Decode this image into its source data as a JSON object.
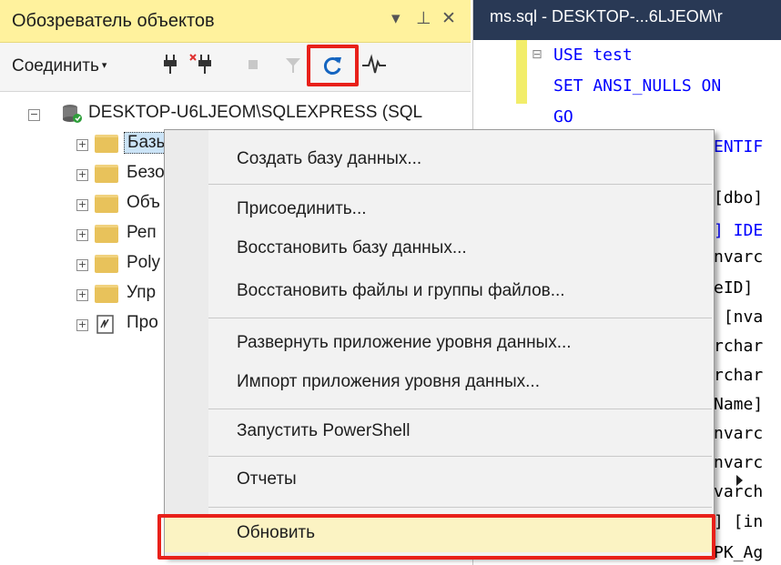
{
  "object_explorer": {
    "title": "Обозреватель объектов",
    "title_controls": {
      "dropdown": "▾",
      "pin": "⊥",
      "close": "✕"
    },
    "toolbar": {
      "connect_label": "Соединить",
      "connect_arrow": "▾"
    },
    "tree": {
      "server": "DESKTOP-U6LJEOM\\SQLEXPRESS (SQL",
      "nodes": [
        {
          "label": "Базы данных"
        },
        {
          "label": "Безо"
        },
        {
          "label": "Объ"
        },
        {
          "label": "Реп"
        },
        {
          "label": "Poly"
        },
        {
          "label": "Упр"
        },
        {
          "label": "Про"
        }
      ],
      "expand_glyph": "+",
      "collapse_glyph": "−"
    }
  },
  "editor": {
    "tab_title": "ms.sql - DESKTOP-...6LJEOM\\r",
    "collapse_glyph": "⊟",
    "lines": [
      {
        "text": "USE test"
      },
      {
        "text": "SET ANSI_NULLS ON"
      },
      {
        "text": "GO"
      },
      {
        "text": "ENTIF"
      },
      {
        "text": "[dbo]"
      },
      {
        "text": "] IDE"
      },
      {
        "text": "nvarc"
      },
      {
        "text": "eID]"
      },
      {
        "text": " [nva"
      },
      {
        "text": "rchar"
      },
      {
        "text": "rchar"
      },
      {
        "text": "Name]"
      },
      {
        "text": "nvarc"
      },
      {
        "text": "nvarc"
      },
      {
        "text": "varch"
      },
      {
        "text": "] [in"
      },
      {
        "text": "PK_Ag"
      }
    ]
  },
  "context_menu": {
    "items": [
      {
        "label": "Создать базу данных..."
      },
      {
        "label": "Присоединить..."
      },
      {
        "label": "Восстановить базу данных..."
      },
      {
        "label": "Восстановить файлы и группы файлов..."
      },
      {
        "label": "Развернуть приложение уровня данных..."
      },
      {
        "label": "Импорт приложения уровня данных..."
      },
      {
        "label": "Запустить PowerShell"
      },
      {
        "label": "Отчеты"
      },
      {
        "label": "Обновить"
      }
    ]
  },
  "colors": {
    "highlight_red": "#e8201a",
    "oe_title_bg": "#fff29d",
    "editor_tab_bg": "#293955",
    "keyword_blue": "#0000ff",
    "menu_hover_bg": "#fbf3c3"
  }
}
